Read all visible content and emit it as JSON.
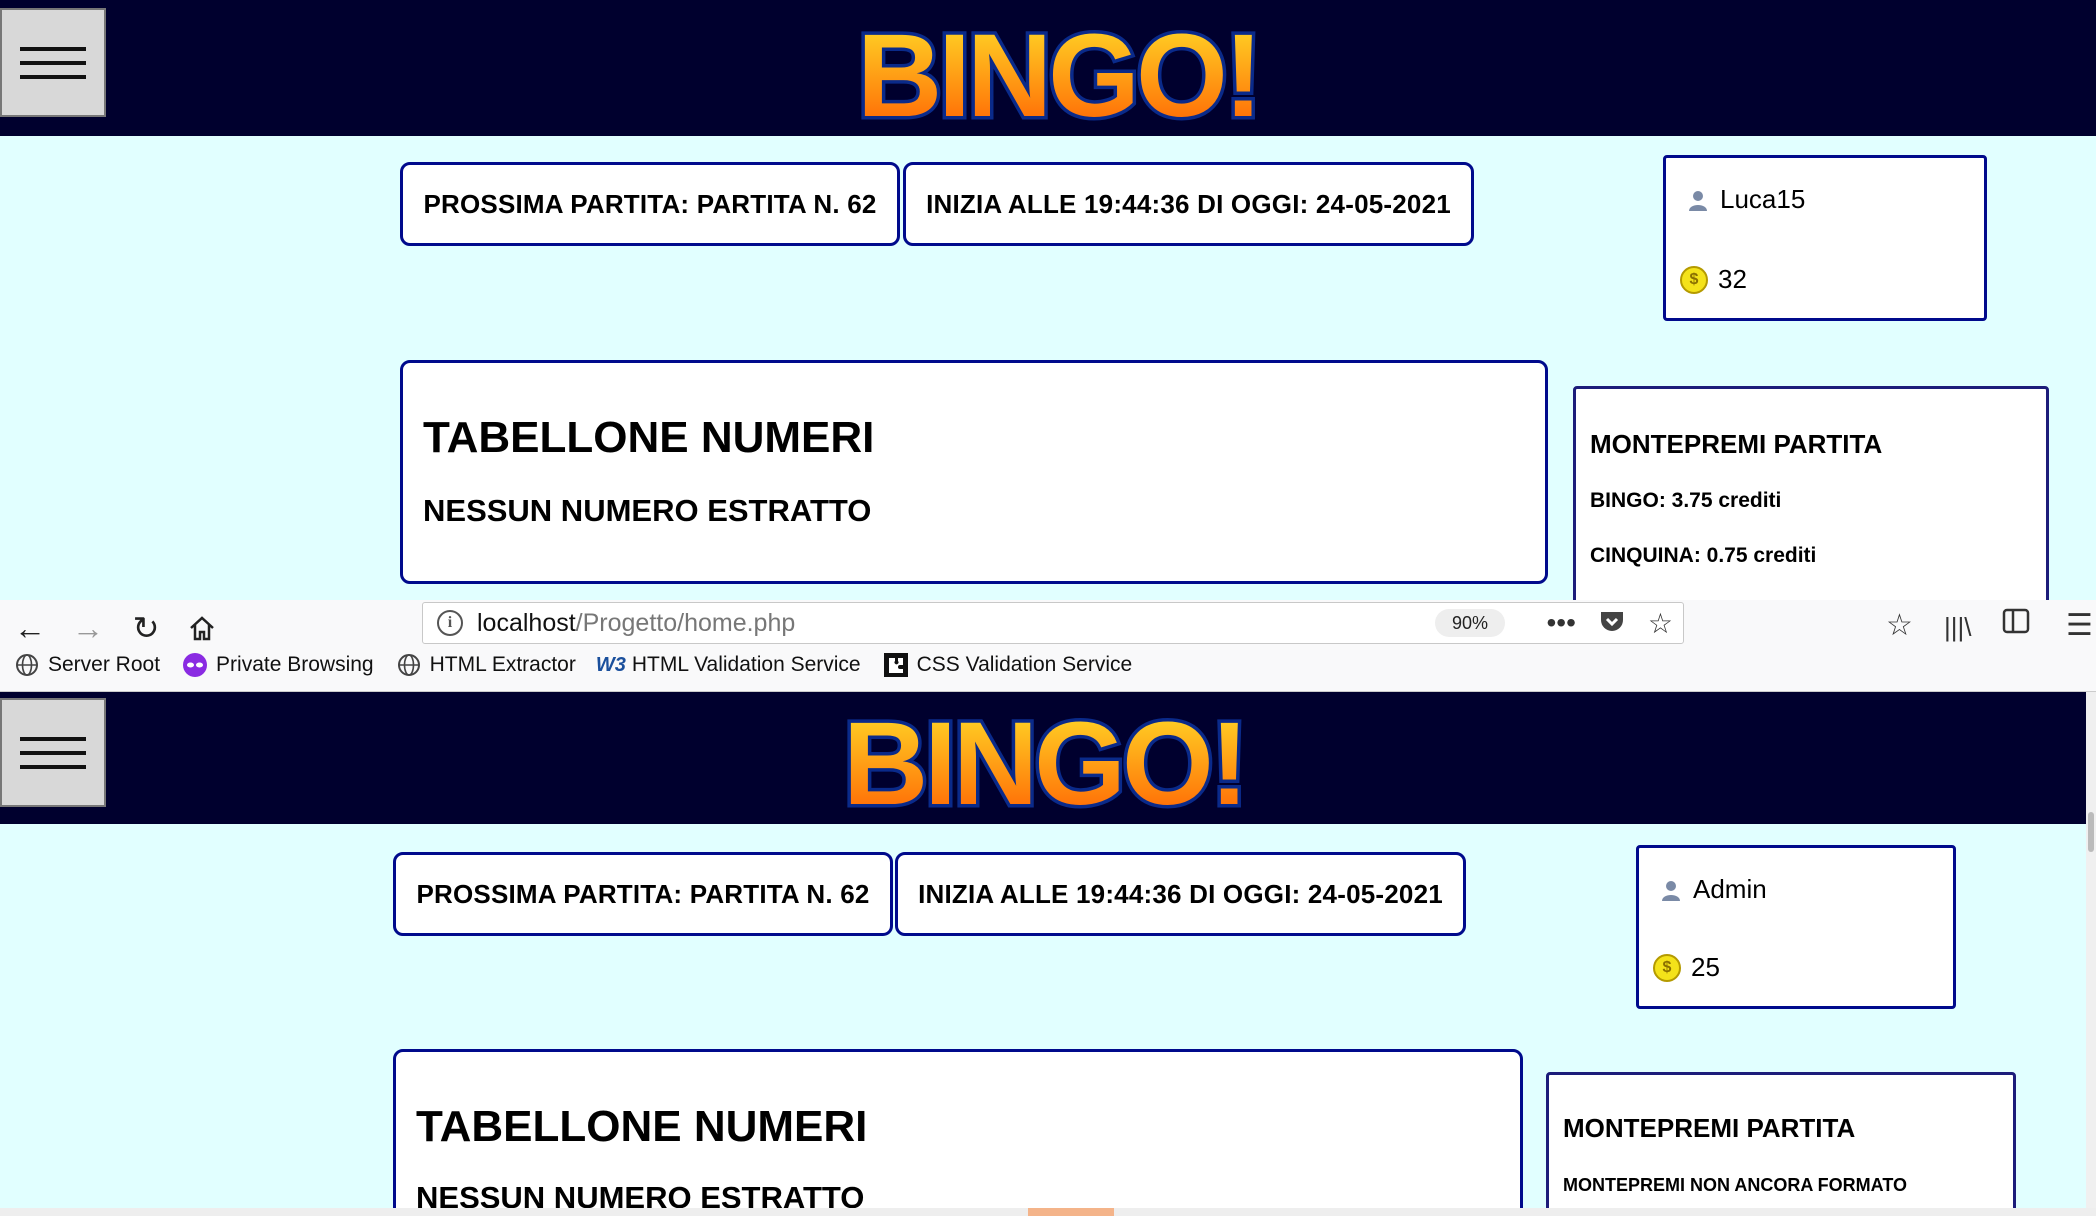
{
  "logo_text": "BINGO!",
  "top": {
    "next_match": "PROSSIMA PARTITA: PARTITA N. 62",
    "start_time": "INIZIA ALLE 19:44:36 DI OGGI: 24-05-2021",
    "user": {
      "name": "Luca15",
      "credits": "32",
      "icon": "user-icon",
      "coin_icon": "coin-icon"
    },
    "board": {
      "title": "TABELLONE NUMERI",
      "status": "NESSUN NUMERO ESTRATTO"
    },
    "prize": {
      "title": "MONTEPREMI PARTITA",
      "line1": "BINGO: 3.75 crediti",
      "line2": "CINQUINA: 0.75 crediti"
    }
  },
  "browser": {
    "url_host": "localhost",
    "url_path": "/Progetto/home.php",
    "zoom": "90%",
    "bookmarks": [
      {
        "label": "Server Root",
        "icon": "globe-icon"
      },
      {
        "label": "Private Browsing",
        "icon": "mask-icon"
      },
      {
        "label": "HTML Extractor",
        "icon": "globe-icon"
      },
      {
        "label": "HTML Validation Service",
        "icon": "w3c-icon"
      },
      {
        "label": "CSS Validation Service",
        "icon": "puzzle-icon"
      }
    ]
  },
  "bottom": {
    "next_match": "PROSSIMA PARTITA: PARTITA N. 62",
    "start_time": "INIZIA ALLE 19:44:36 DI OGGI: 24-05-2021",
    "user": {
      "name": "Admin",
      "credits": "25",
      "icon": "user-icon",
      "coin_icon": "coin-icon"
    },
    "board": {
      "title": "TABELLONE NUMERI",
      "status": "NESSUN NUMERO ESTRATTO"
    },
    "prize": {
      "title": "MONTEPREMI PARTITA",
      "line1": "MONTEPREMI NON ANCORA FORMATO"
    }
  },
  "colors": {
    "header_bg": "#00002e",
    "page_bg": "#e1ffff",
    "border": "#000a8c",
    "logo_fill_top": "#ffd21a",
    "logo_fill_bottom": "#ff6a00"
  }
}
